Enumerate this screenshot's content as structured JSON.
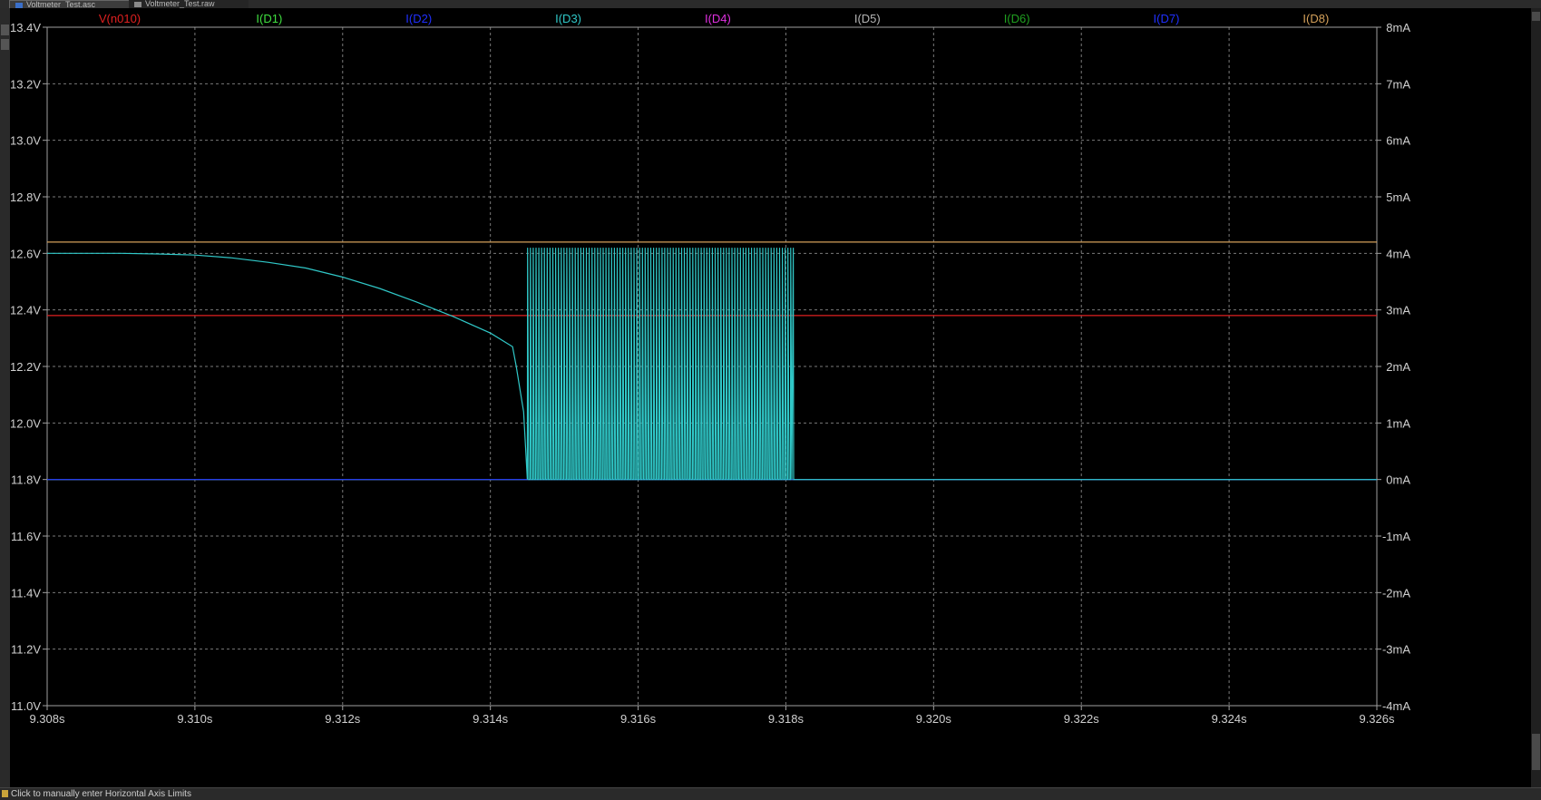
{
  "tabs": [
    {
      "label": "Voltmeter_Test.asc",
      "icon": "schematic-icon",
      "active": true
    },
    {
      "label": "Voltmeter_Test.raw",
      "icon": "waveform-icon",
      "active": false
    }
  ],
  "status": {
    "text": "Click to manually enter Horizontal Axis Limits"
  },
  "colors": {
    "background": "#000000",
    "grid": "#7a7a7a",
    "axis_text": "#d0d0d0",
    "frame": "#a0a0a0"
  },
  "chart_data": {
    "type": "line",
    "title": "",
    "xlabel": "",
    "ylabel": "",
    "y2label": "",
    "xlim": [
      9.308,
      9.326
    ],
    "ylim": [
      11.0,
      13.4
    ],
    "y2lim": [
      -4,
      8
    ],
    "x_ticks": [
      "9.308s",
      "9.310s",
      "9.312s",
      "9.314s",
      "9.316s",
      "9.318s",
      "9.320s",
      "9.322s",
      "9.324s",
      "9.326s"
    ],
    "x_tick_values": [
      9.308,
      9.31,
      9.312,
      9.314,
      9.316,
      9.318,
      9.32,
      9.322,
      9.324,
      9.326
    ],
    "y_ticks": [
      "13.4V",
      "13.2V",
      "13.0V",
      "12.8V",
      "12.6V",
      "12.4V",
      "12.2V",
      "12.0V",
      "11.8V",
      "11.6V",
      "11.4V",
      "11.2V",
      "11.0V"
    ],
    "y_tick_values": [
      13.4,
      13.2,
      13.0,
      12.8,
      12.6,
      12.4,
      12.2,
      12.0,
      11.8,
      11.6,
      11.4,
      11.2,
      11.0
    ],
    "y2_ticks": [
      "8mA",
      "7mA",
      "6mA",
      "5mA",
      "4mA",
      "3mA",
      "2mA",
      "1mA",
      "0mA",
      "-1mA",
      "-2mA",
      "-3mA",
      "-4mA"
    ],
    "y2_tick_values": [
      8,
      7,
      6,
      5,
      4,
      3,
      2,
      1,
      0,
      -1,
      -2,
      -3,
      -4
    ],
    "grid": true,
    "legend_position": "top",
    "series": [
      {
        "name": "V(n010)",
        "color": "#e02020",
        "axis": "left",
        "x": [
          9.308,
          9.326
        ],
        "y": [
          12.38,
          12.38
        ]
      },
      {
        "name": "I(D1)",
        "color": "#40e040",
        "axis": "right",
        "x": [
          9.308,
          9.326
        ],
        "y": [
          0,
          0
        ]
      },
      {
        "name": "I(D2)",
        "color": "#2030ff",
        "axis": "right",
        "x": [
          9.308,
          9.326
        ],
        "y": [
          0,
          0
        ]
      },
      {
        "name": "I(D3)",
        "color": "#30c8c8",
        "axis": "right",
        "x": [
          9.308,
          9.309,
          9.3095,
          9.31,
          9.3105,
          9.311,
          9.3115,
          9.312,
          9.3125,
          9.313,
          9.3135,
          9.314,
          9.3143,
          9.31435,
          9.3144,
          9.31445,
          9.3145,
          9.3181,
          9.3182,
          9.326
        ],
        "y": [
          4.0,
          4.0,
          3.99,
          3.97,
          3.92,
          3.84,
          3.74,
          3.58,
          3.38,
          3.14,
          2.88,
          2.59,
          2.35,
          2.0,
          1.6,
          1.2,
          0.0,
          0.0,
          0.0,
          0.0
        ],
        "oscillation": {
          "x_start": 9.3145,
          "x_end": 9.3181,
          "low": 0,
          "high": 4.1,
          "cycles": 95
        }
      },
      {
        "name": "I(D4)",
        "color": "#e030e0",
        "axis": "right",
        "x": [
          9.308,
          9.326
        ],
        "y": [
          0,
          0
        ]
      },
      {
        "name": "I(D5)",
        "color": "#b4b4b4",
        "axis": "right",
        "x": [
          9.308,
          9.326
        ],
        "y": [
          0,
          0
        ]
      },
      {
        "name": "I(D6)",
        "color": "#20a020",
        "axis": "right",
        "x": [
          9.308,
          9.326
        ],
        "y": [
          0,
          0
        ]
      },
      {
        "name": "I(D7)",
        "color": "#2030ff",
        "axis": "right",
        "x": [
          9.308,
          9.326
        ],
        "y": [
          0,
          0
        ]
      },
      {
        "name": "I(D8)",
        "color": "#d4a05a",
        "axis": "right",
        "x": [
          9.308,
          9.326
        ],
        "y": [
          4.2,
          4.2
        ]
      }
    ]
  }
}
